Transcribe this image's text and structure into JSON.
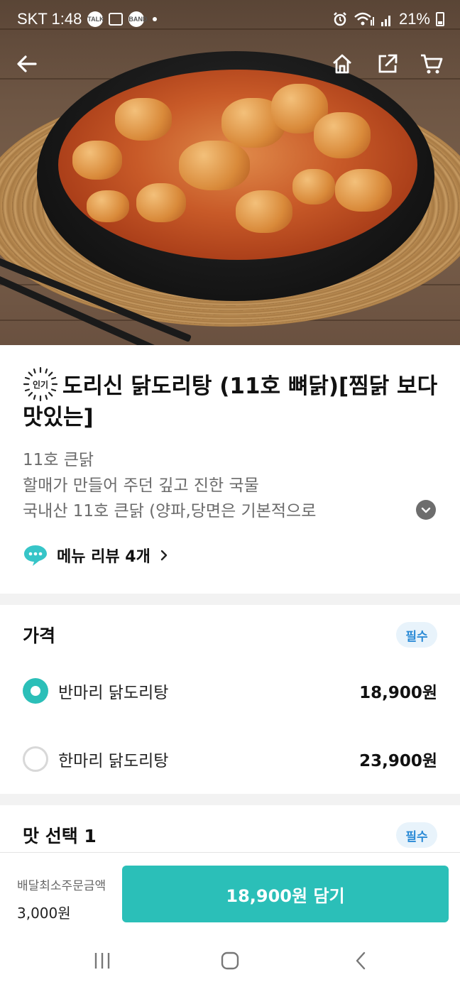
{
  "status_bar": {
    "carrier_time": "SKT 1:48",
    "icons": [
      "talk-icon",
      "gallery-icon",
      "band-icon"
    ],
    "talk_label": "TALK",
    "band_label": "BAND",
    "battery": "21%"
  },
  "nav": {
    "back_icon": "arrow-left-icon",
    "home_icon": "home-icon",
    "share_icon": "share-icon",
    "cart_icon": "cart-icon"
  },
  "product": {
    "popular_badge": "인기",
    "title": "도리신 닭도리탕 (11호 뼈닭)[찜닭 보다 맛있는]",
    "description_lines": [
      "11호 큰닭",
      "할매가 만들어 주던 깊고 진한 국물",
      "국내산 11호 큰닭 (양파,당면은 기본적으로"
    ],
    "review_label": "메뉴 리뷰 4개"
  },
  "price_section": {
    "title": "가격",
    "required_label": "필수",
    "options": [
      {
        "label": "반마리 닭도리탕",
        "price": "18,900원",
        "selected": true
      },
      {
        "label": "한마리 닭도리탕",
        "price": "23,900원",
        "selected": false
      }
    ]
  },
  "taste_section": {
    "title": "맛 선택 1",
    "required_label": "필수"
  },
  "bottom": {
    "min_order_label": "배달최소주문금액",
    "min_order_value": "3,000원",
    "add_button_label": "18,900원 담기"
  },
  "colors": {
    "accent": "#2bbfb8",
    "required_badge_bg": "#e8f3fb",
    "required_badge_text": "#2a8ad6"
  }
}
